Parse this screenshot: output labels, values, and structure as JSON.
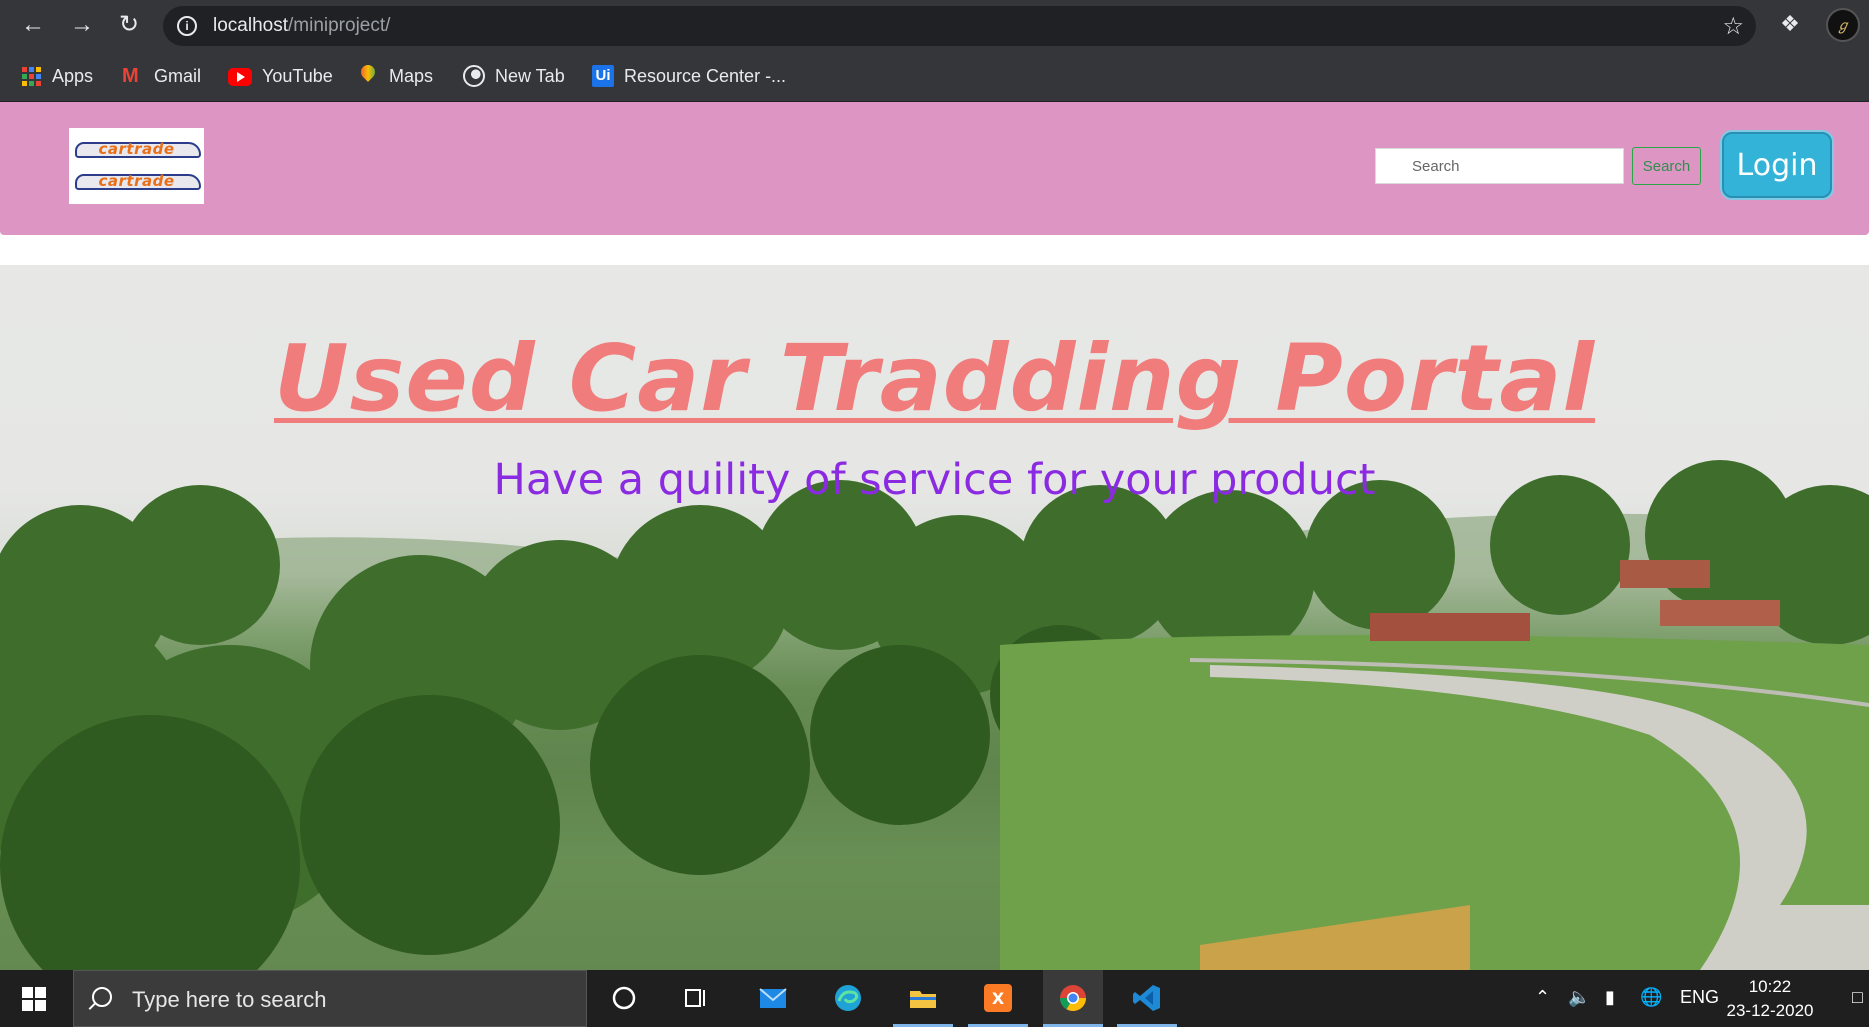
{
  "browser": {
    "url_host": "localhost",
    "url_path": "/miniproject/",
    "bookmarks": [
      {
        "label": "Apps",
        "icon": "apps-grid-icon"
      },
      {
        "label": "Gmail",
        "icon": "gmail-icon"
      },
      {
        "label": "YouTube",
        "icon": "youtube-icon"
      },
      {
        "label": "Maps",
        "icon": "maps-icon"
      },
      {
        "label": "New Tab",
        "icon": "globe-icon"
      },
      {
        "label": "Resource Center -...",
        "icon": "ui-icon"
      }
    ]
  },
  "header": {
    "logo_text": "cartrade",
    "search_placeholder": "Search",
    "search_button": "Search",
    "login_button": "Login"
  },
  "hero": {
    "title": "Used Car Tradding Portal",
    "subtitle": "Have a quility of service for your product"
  },
  "taskbar": {
    "search_placeholder": "Type here to search",
    "language": "ENG",
    "time": "10:22",
    "date": "23-12-2020"
  },
  "colors": {
    "header_bg": "#dd95c4",
    "title": "#f07c7c",
    "subtitle": "#8a2be2",
    "login_bg": "#33b3d8"
  }
}
